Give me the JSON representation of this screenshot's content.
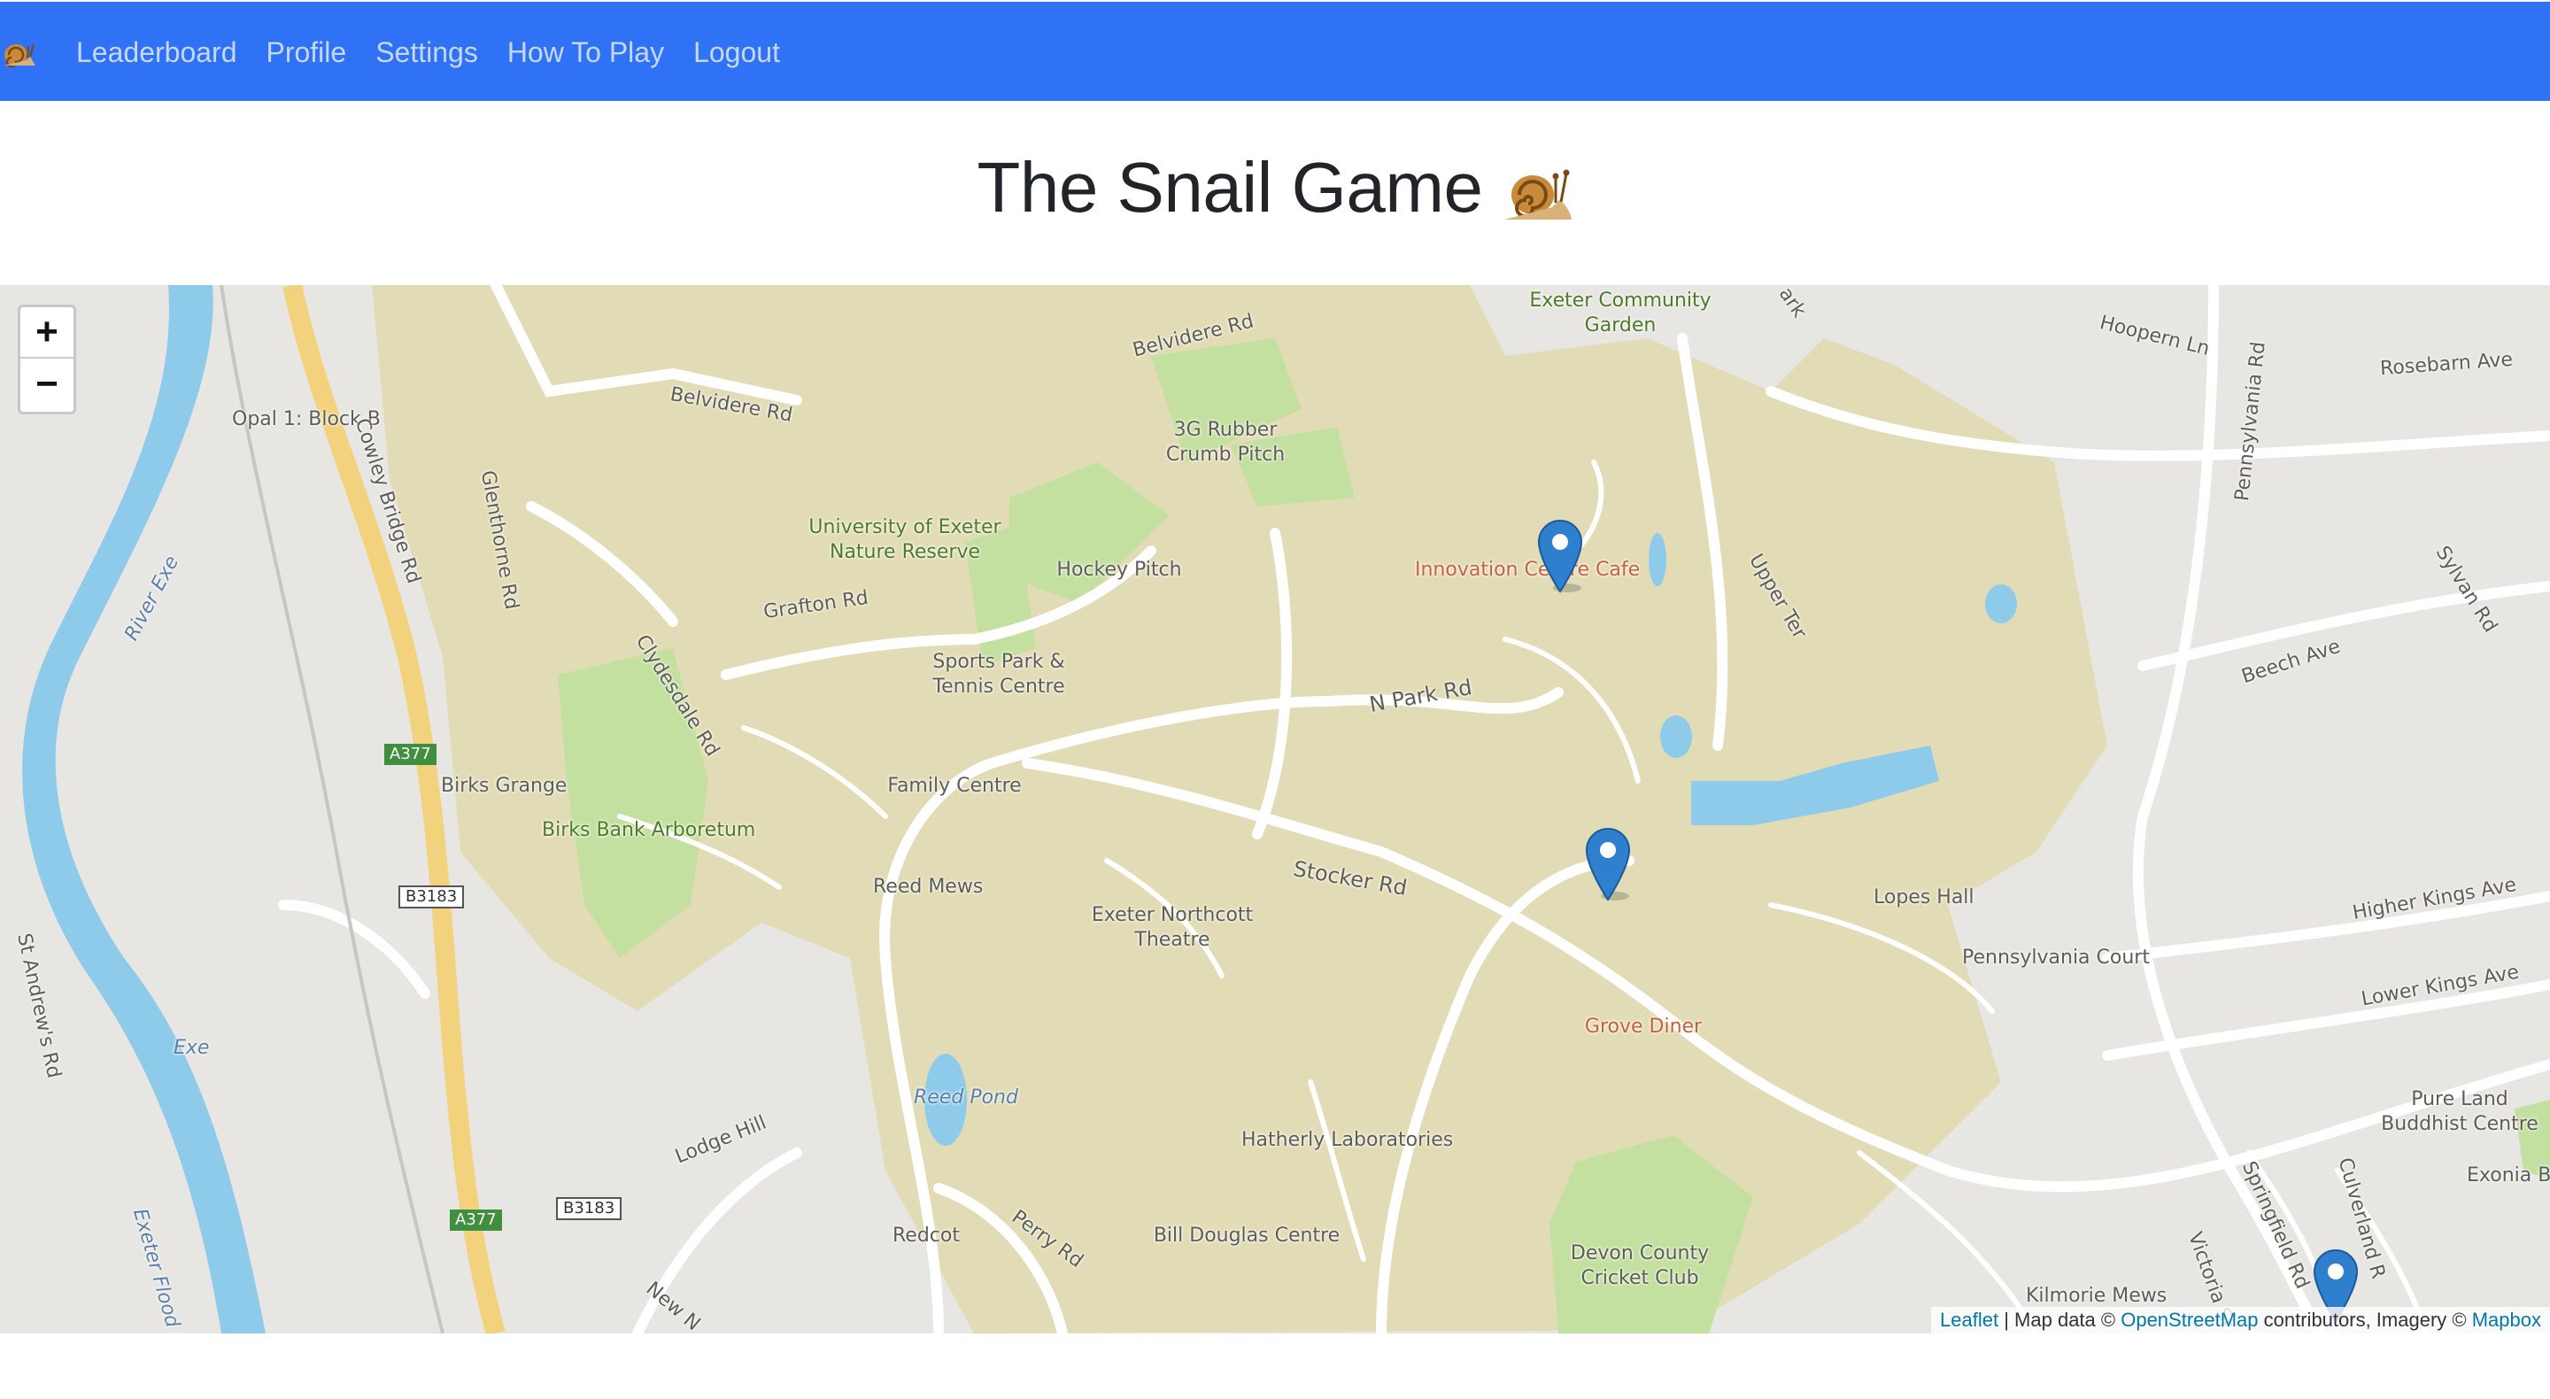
{
  "nav": {
    "brand_icon": "snail-emoji",
    "links": [
      "Leaderboard",
      "Profile",
      "Settings",
      "How To Play",
      "Logout"
    ]
  },
  "page": {
    "title": "The Snail Game",
    "title_icon": "snail-emoji"
  },
  "map": {
    "zoom_in": "+",
    "zoom_out": "−",
    "labels": {
      "exeter_garden": "Exeter Community\nGarden",
      "belvidere_rd_top": "Belvidere Rd",
      "belvidere_rd": "Belvidere Rd",
      "opal": "Opal 1: Block B",
      "cowley": "Cowley Bridge Rd",
      "glenthorne": "Glenthorne Rd",
      "rubber_pitch": "3G Rubber\nCrumb Pitch",
      "nature_reserve": "University of Exeter\nNature Reserve",
      "hockey": "Hockey Pitch",
      "innovation": "Innovation Centre Cafe",
      "grafton": "Grafton Rd",
      "sports_park": "Sports Park &\nTennis Centre",
      "river_exe": "River Exe",
      "clydesdale": "Clydesdale Rd",
      "n_park": "N Park Rd",
      "family": "Family Centre",
      "birks_grange": "Birks Grange",
      "birks_bank": "Birks Bank Arboretum",
      "a377_top": "A377",
      "a377_bottom": "A377",
      "b3183_top": "B3183",
      "b3183_bottom": "B3183",
      "reed_mews": "Reed Mews",
      "northcott": "Exeter Northcott\nTheatre",
      "stocker": "Stocker Rd",
      "grove": "Grove Diner",
      "lopes": "Lopes Hall",
      "pennsylvania_court": "Pennsylvania Court",
      "st_andrews": "St Andrew's Rd",
      "exe": "Exe",
      "lodge_hill": "Lodge Hill",
      "reed_pond": "Reed Pond",
      "hatherly": "Hatherly Laboratories",
      "flood_relief": "Exeter Flood Relief Ch",
      "redcot": "Redcot",
      "perry": "Perry Rd",
      "bill_douglas": "Bill Douglas Centre",
      "new_n": "New N",
      "devon_cricket": "Devon County\nCricket Club",
      "kilmorie": "Kilmorie Mews",
      "hoopern": "Hoopern Ln",
      "rosebarn": "Rosebarn Ave",
      "pennsylvania_rd": "Pennsylvania Rd",
      "park": "ark",
      "upper_ter": "Upper Ter",
      "sylvan": "Sylvan Rd",
      "beech": "Beech Ave",
      "higher_kings": "Higher Kings Ave",
      "lower_kings": "Lower Kings Ave",
      "pure_land": "Pure Land\nBuddhist Centre",
      "exonia": "Exonia Bo",
      "springfield": "Springfield Rd",
      "culverland": "Culverland R",
      "victoria": "Victoria St"
    },
    "attribution": {
      "leaflet": "Leaflet",
      "sep": " | Map data © ",
      "osm": "OpenStreetMap",
      "mid": " contributors, Imagery © ",
      "mapbox": "Mapbox"
    },
    "colors": {
      "campus": "#e2dcb6",
      "park": "#c4e0a0",
      "water": "#8ecbea",
      "road": "#ffffff",
      "major_road": "#f2d27c",
      "marker": "#2f7fcf",
      "navbar": "#2f72f5"
    }
  }
}
